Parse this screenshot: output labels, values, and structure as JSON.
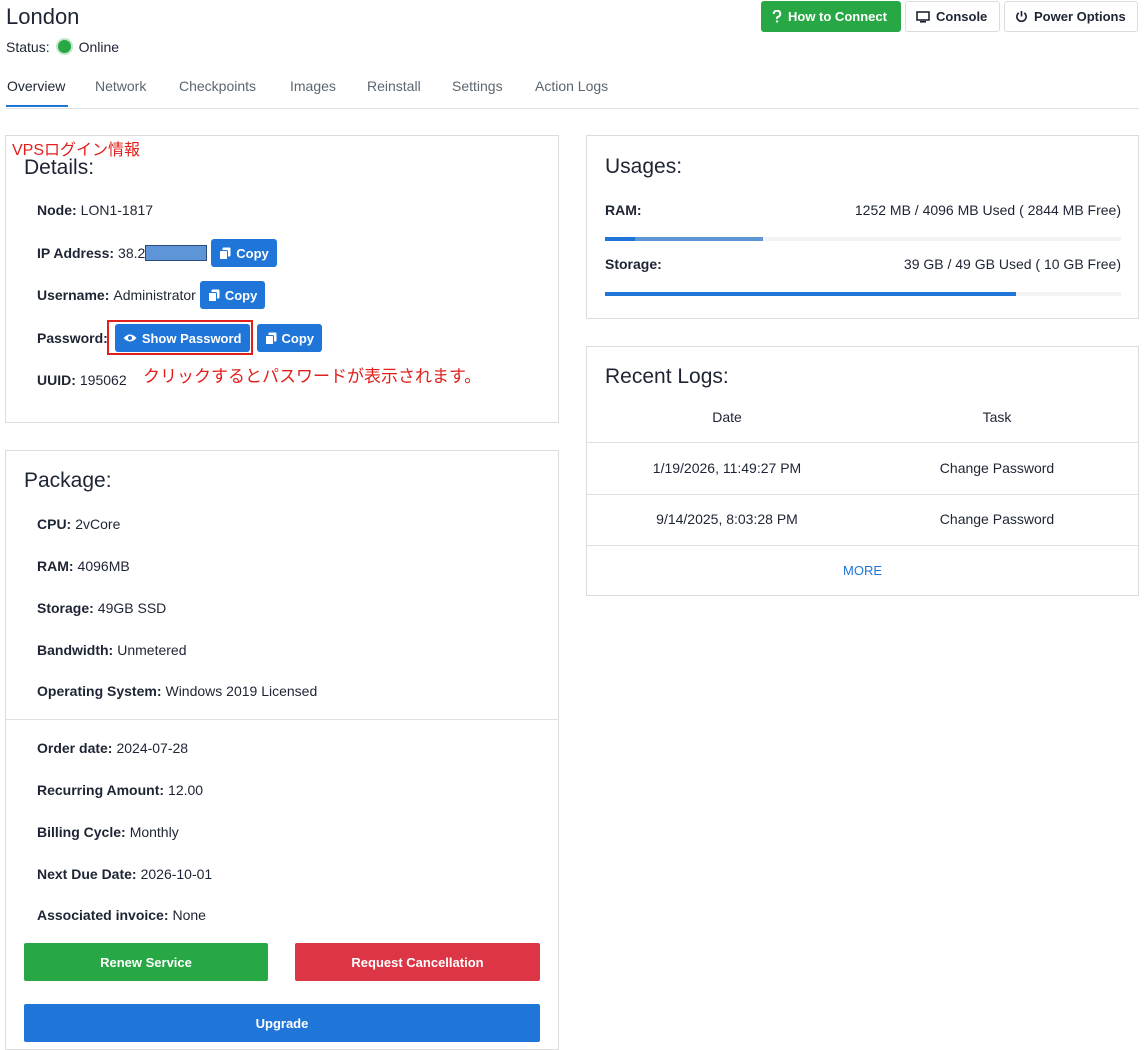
{
  "header": {
    "title": "London",
    "status_label": "Status:",
    "status_value": "Online",
    "buttons": {
      "how_to_connect": "How to Connect",
      "console": "Console",
      "power_options": "Power Options"
    }
  },
  "tabs": [
    "Overview",
    "Network",
    "Checkpoints",
    "Images",
    "Reinstall",
    "Settings",
    "Action Logs"
  ],
  "details": {
    "annotation": "VPSログイン情報",
    "heading": "Details:",
    "node_label": "Node:",
    "node_value": "LON1-1817",
    "ip_label": "IP Address:",
    "ip_value": "38.2",
    "username_label": "Username:",
    "username_value": "Administrator",
    "password_label": "Password:",
    "show_password": "Show Password",
    "copy": "Copy",
    "uuid_label": "UUID:",
    "uuid_value": "195062",
    "password_note": "クリックするとパスワードが表示されます。"
  },
  "package": {
    "heading": "Package:",
    "cpu_label": "CPU:",
    "cpu_value": "2vCore",
    "ram_label": "RAM:",
    "ram_value": "4096MB",
    "storage_label": "Storage:",
    "storage_value": "49GB SSD",
    "bandwidth_label": "Bandwidth:",
    "bandwidth_value": "Unmetered",
    "os_label": "Operating System:",
    "os_value": "Windows 2019 Licensed",
    "order_date_label": "Order date:",
    "order_date_value": "2024-07-28",
    "recurring_label": "Recurring Amount:",
    "recurring_value": "12.00",
    "billing_label": "Billing Cycle:",
    "billing_value": "Monthly",
    "due_label": "Next Due Date:",
    "due_value": "2026-10-01",
    "invoice_label": "Associated invoice:",
    "invoice_value": "None",
    "renew": "Renew Service",
    "cancel": "Request Cancellation",
    "upgrade": "Upgrade"
  },
  "usages": {
    "heading": "Usages:",
    "ram_label": "RAM:",
    "ram_value": "1252 MB / 4096 MB Used ( 2844 MB Free)",
    "ram_used_fraction": 0.3057,
    "storage_label": "Storage:",
    "storage_value": "39 GB / 49 GB Used ( 10 GB Free)",
    "storage_used_fraction": 0.7959
  },
  "logs": {
    "heading": "Recent Logs:",
    "col_date": "Date",
    "col_task": "Task",
    "rows": [
      {
        "date": "1/19/2026, 11:49:27 PM",
        "task": "Change Password"
      },
      {
        "date": "9/14/2025, 8:03:28 PM",
        "task": "Change Password"
      }
    ],
    "more": "MORE"
  },
  "colors": {
    "primary": "#1f75d8",
    "success": "#28a745",
    "danger": "#dc3545",
    "annotation": "#e0201b"
  }
}
